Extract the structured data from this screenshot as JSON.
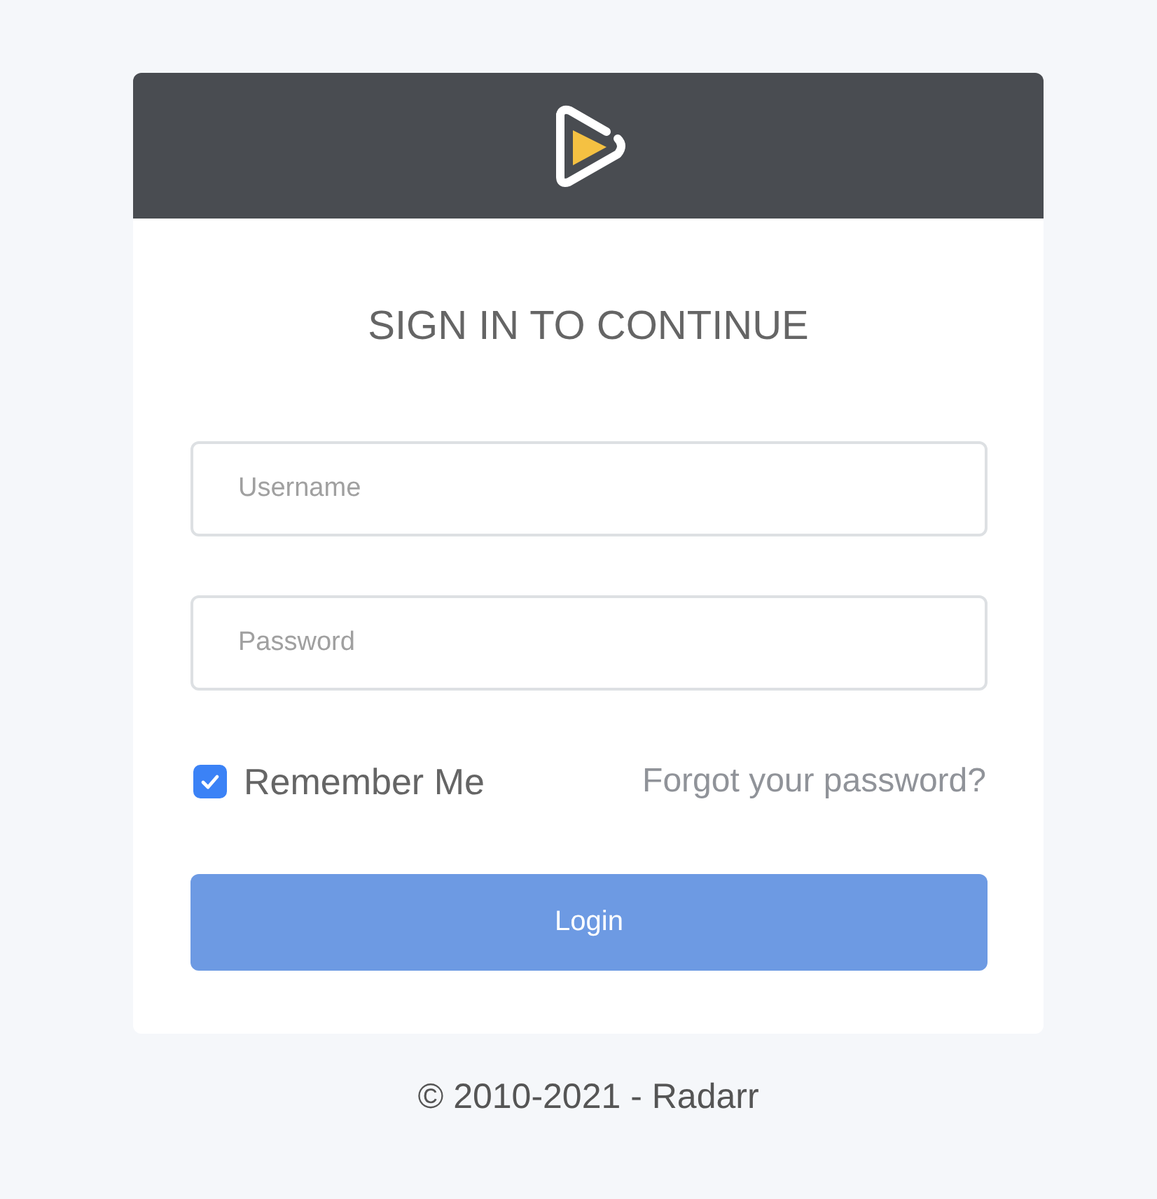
{
  "heading": "SIGN IN TO CONTINUE",
  "username": {
    "placeholder": "Username"
  },
  "password": {
    "placeholder": "Password"
  },
  "remember": {
    "label": "Remember Me",
    "checked": true
  },
  "forgot_link": "Forgot your password?",
  "login_button": "Login",
  "footer": "© 2010-2021 - Radarr"
}
